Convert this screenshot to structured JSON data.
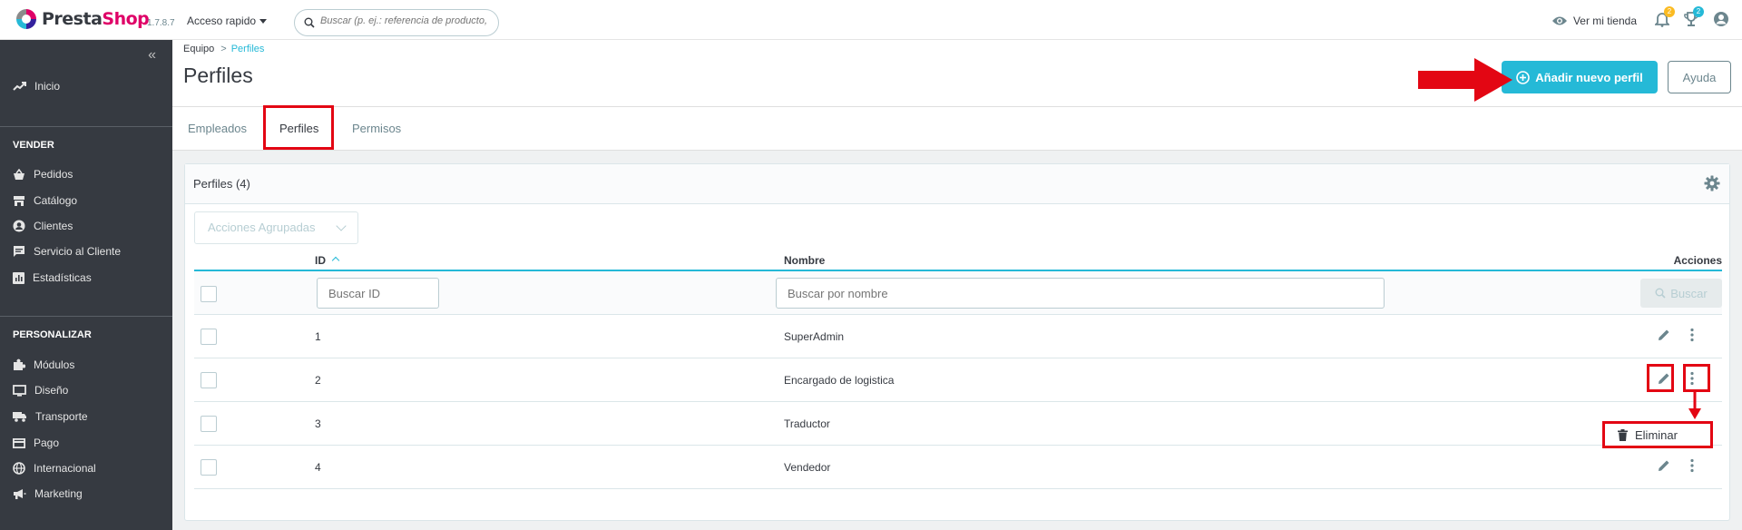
{
  "header": {
    "logo_pre": "Presta",
    "logo_post": "Shop",
    "version": "1.7.8.7",
    "quick_access": "Acceso rapido",
    "search_placeholder": "Buscar (p. ej.: referencia de producto,",
    "view_shop": "Ver mi tienda",
    "notifications_count": "2",
    "orders_count": "2"
  },
  "sidebar": {
    "collapse": "«",
    "home": "Inicio",
    "section_sell": "VENDER",
    "sell_items": [
      "Pedidos",
      "Catálogo",
      "Clientes",
      "Servicio al Cliente",
      "Estadísticas"
    ],
    "section_customize": "PERSONALIZAR",
    "customize_items": [
      "Módulos",
      "Diseño",
      "Transporte",
      "Pago",
      "Internacional",
      "Marketing"
    ]
  },
  "breadcrumb": {
    "parent": "Equipo",
    "current": "Perfiles"
  },
  "page": {
    "title": "Perfiles",
    "add_button": "Añadir nuevo perfil",
    "help_button": "Ayuda"
  },
  "tabs": [
    "Empleados",
    "Perfiles",
    "Permisos"
  ],
  "panel": {
    "title": "Perfiles (4)",
    "bulk_actions": "Acciones Agrupadas",
    "columns": {
      "id": "ID",
      "name": "Nombre",
      "actions": "Acciones"
    },
    "filter_id_placeholder": "Buscar ID",
    "filter_name_placeholder": "Buscar por nombre",
    "search_button": "Buscar",
    "rows": [
      {
        "id": "1",
        "name": "SuperAdmin"
      },
      {
        "id": "2",
        "name": "Encargado de logistica"
      },
      {
        "id": "3",
        "name": "Traductor"
      },
      {
        "id": "4",
        "name": "Vendedor"
      }
    ],
    "dropdown_delete": "Eliminar"
  },
  "colors": {
    "accent": "#25b9d7",
    "annotation_red": "#e30613",
    "sidebar_bg": "#363a41"
  }
}
